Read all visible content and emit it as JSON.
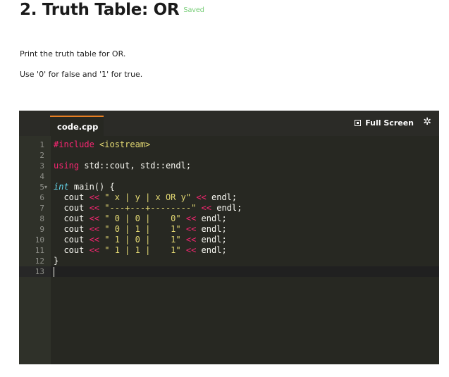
{
  "header": {
    "title": "2. Truth Table: OR",
    "status": "Saved"
  },
  "instructions": [
    "Print the truth table for OR.",
    "Use '0' for false and '1' for true."
  ],
  "editor": {
    "tab": "code.cpp",
    "fullscreen_label": "Full Screen",
    "active_line": 13,
    "lines": [
      {
        "n": "1",
        "tokens": [
          {
            "t": "#include ",
            "c": "kw"
          },
          {
            "t": "<iostream>",
            "c": "inc"
          }
        ]
      },
      {
        "n": "2",
        "tokens": []
      },
      {
        "n": "3",
        "tokens": [
          {
            "t": "using",
            "c": "kw"
          },
          {
            "t": " std::cout, std::endl;",
            "c": ""
          }
        ]
      },
      {
        "n": "4",
        "tokens": []
      },
      {
        "n": "5",
        "fold": true,
        "tokens": [
          {
            "t": "int",
            "c": "type"
          },
          {
            "t": " main() {",
            "c": ""
          }
        ]
      },
      {
        "n": "6",
        "tokens": [
          {
            "t": "  cout ",
            "c": ""
          },
          {
            "t": "<<",
            "c": "op"
          },
          {
            "t": " ",
            "c": ""
          },
          {
            "t": "\" x | y | x OR y\"",
            "c": "str"
          },
          {
            "t": " ",
            "c": ""
          },
          {
            "t": "<<",
            "c": "op"
          },
          {
            "t": " endl;",
            "c": ""
          }
        ]
      },
      {
        "n": "7",
        "tokens": [
          {
            "t": "  cout ",
            "c": ""
          },
          {
            "t": "<<",
            "c": "op"
          },
          {
            "t": " ",
            "c": ""
          },
          {
            "t": "\"---+---+--------\"",
            "c": "str"
          },
          {
            "t": " ",
            "c": ""
          },
          {
            "t": "<<",
            "c": "op"
          },
          {
            "t": " endl;",
            "c": ""
          }
        ]
      },
      {
        "n": "8",
        "tokens": [
          {
            "t": "  cout ",
            "c": ""
          },
          {
            "t": "<<",
            "c": "op"
          },
          {
            "t": " ",
            "c": ""
          },
          {
            "t": "\" 0 | 0 |    0\"",
            "c": "str"
          },
          {
            "t": " ",
            "c": ""
          },
          {
            "t": "<<",
            "c": "op"
          },
          {
            "t": " endl;",
            "c": ""
          }
        ]
      },
      {
        "n": "9",
        "tokens": [
          {
            "t": "  cout ",
            "c": ""
          },
          {
            "t": "<<",
            "c": "op"
          },
          {
            "t": " ",
            "c": ""
          },
          {
            "t": "\" 0 | 1 |    1\"",
            "c": "str"
          },
          {
            "t": " ",
            "c": ""
          },
          {
            "t": "<<",
            "c": "op"
          },
          {
            "t": " endl;",
            "c": ""
          }
        ]
      },
      {
        "n": "10",
        "tokens": [
          {
            "t": "  cout ",
            "c": ""
          },
          {
            "t": "<<",
            "c": "op"
          },
          {
            "t": " ",
            "c": ""
          },
          {
            "t": "\" 1 | 0 |    1\"",
            "c": "str"
          },
          {
            "t": " ",
            "c": ""
          },
          {
            "t": "<<",
            "c": "op"
          },
          {
            "t": " endl;",
            "c": ""
          }
        ]
      },
      {
        "n": "11",
        "tokens": [
          {
            "t": "  cout ",
            "c": ""
          },
          {
            "t": "<<",
            "c": "op"
          },
          {
            "t": " ",
            "c": ""
          },
          {
            "t": "\" 1 | 1 |    1\"",
            "c": "str"
          },
          {
            "t": " ",
            "c": ""
          },
          {
            "t": "<<",
            "c": "op"
          },
          {
            "t": " endl;",
            "c": ""
          }
        ]
      },
      {
        "n": "12",
        "tokens": [
          {
            "t": "}",
            "c": ""
          }
        ]
      },
      {
        "n": "13",
        "tokens": []
      }
    ]
  },
  "icons": {
    "fullscreen": "fullscreen-icon",
    "settings": "gear-icon",
    "fold": "fold-arrow-icon"
  },
  "colors": {
    "editor_bg": "#272822",
    "tab_accent": "#e67e22",
    "saved": "#7ccf7c",
    "keyword": "#f92672",
    "string": "#e6db74",
    "type": "#66d9ef"
  }
}
